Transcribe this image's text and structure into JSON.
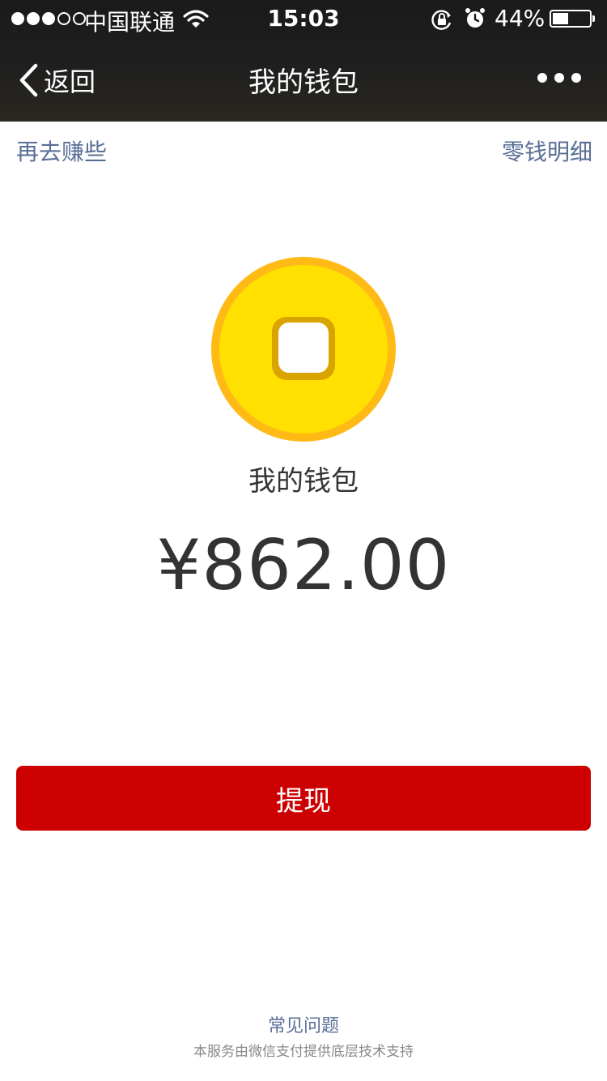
{
  "status_bar": {
    "carrier": "中国联通",
    "time": "15:03",
    "battery": "44%",
    "battery_level": 0.44,
    "signal_bars": 3,
    "icons": [
      "wifi-icon",
      "rotation-lock-icon",
      "alarm-icon",
      "battery-icon"
    ]
  },
  "nav": {
    "back_label": "返回",
    "title": "我的钱包",
    "more_icon": "more-dots-icon"
  },
  "links": {
    "left": "再去赚些",
    "right": "零钱明细"
  },
  "wallet": {
    "icon": "coin-icon",
    "title": "我的钱包",
    "amount": "¥862.00"
  },
  "actions": {
    "withdraw_label": "提现"
  },
  "footer": {
    "faq": "常见问题",
    "note": "本服务由微信支付提供底层技术支持"
  },
  "colors": {
    "accent_red": "#cc0000",
    "link_blue": "#5a6f96",
    "coin_yellow": "#ffe000",
    "coin_rim": "#ffba16"
  }
}
